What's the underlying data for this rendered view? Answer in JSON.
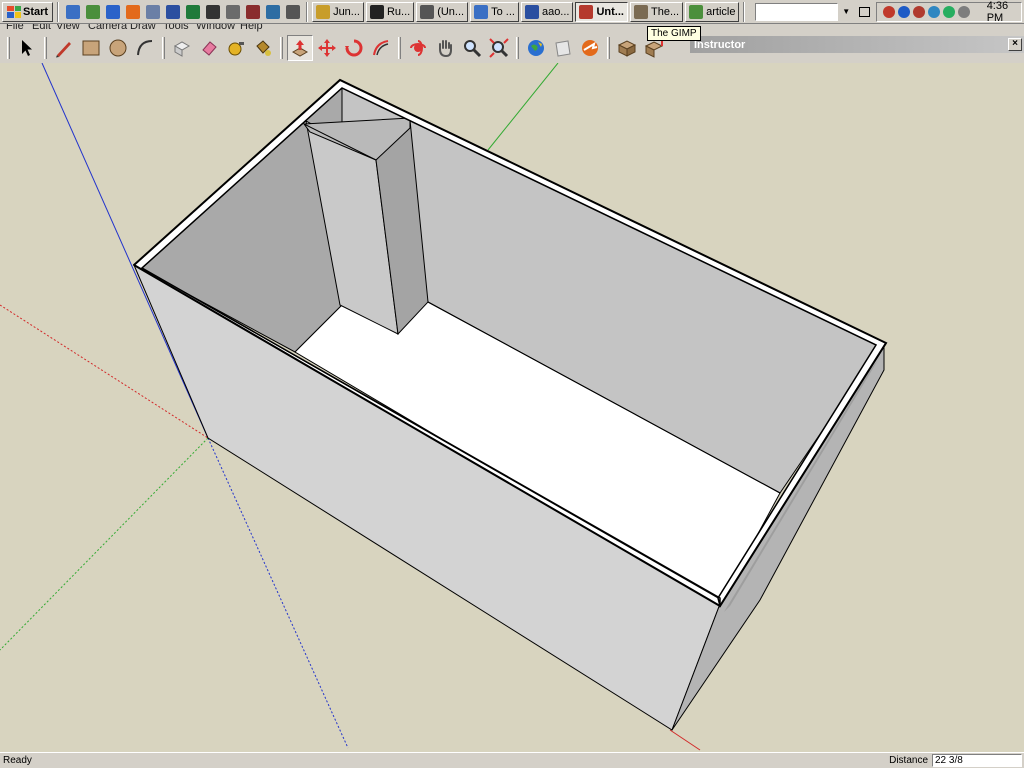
{
  "taskbar": {
    "start_label": "Start",
    "quick_launch": [
      {
        "icon": "notepad-icon",
        "color": "#3a6fc4"
      },
      {
        "icon": "search-icon",
        "color": "#4b8f3c"
      },
      {
        "icon": "internet-explorer-icon",
        "color": "#2a62c9"
      },
      {
        "icon": "firefox-icon",
        "color": "#e36a1b"
      },
      {
        "icon": "windows-explorer-icon",
        "color": "#6a7fa6"
      },
      {
        "icon": "word-icon",
        "color": "#2b4fa0"
      },
      {
        "icon": "excel-icon",
        "color": "#1f7a3a"
      },
      {
        "icon": "media-icon",
        "color": "#333333"
      },
      {
        "icon": "pen-icon",
        "color": "#6b6b6b"
      },
      {
        "icon": "scissors-icon",
        "color": "#8a2d2d"
      },
      {
        "icon": "display-icon",
        "color": "#2d6da3"
      },
      {
        "icon": "arrows-icon",
        "color": "#555555"
      }
    ],
    "tasks": [
      {
        "label": "Jun...",
        "color": "#c89d2a",
        "active": false
      },
      {
        "label": "Ru...",
        "color": "#222222",
        "active": false
      },
      {
        "label": "(Un...",
        "color": "#555555",
        "active": false
      },
      {
        "label": "To ...",
        "color": "#3a6fc4",
        "active": false
      },
      {
        "label": "aao...",
        "color": "#2b4fa0",
        "active": false
      },
      {
        "label": "Unt...",
        "color": "#b5392d",
        "active": true
      },
      {
        "label": "The...",
        "color": "#7a6a52",
        "active": false
      },
      {
        "label": "article",
        "color": "#4b8f3c",
        "active": false
      }
    ],
    "tray_icons": [
      {
        "icon": "shield-icon",
        "color": "#c0392b"
      },
      {
        "icon": "antivirus-icon",
        "color": "#1e5bc6"
      },
      {
        "icon": "security-icon",
        "color": "#b03a2e"
      },
      {
        "icon": "network-icon",
        "color": "#2e86c1"
      },
      {
        "icon": "globe-icon",
        "color": "#27ae60"
      },
      {
        "icon": "volume-icon",
        "color": "#7d7d7d"
      }
    ],
    "clock": "4:36 PM"
  },
  "tooltip": "The GIMP",
  "menu": [
    "File",
    "Edit",
    "View",
    "Camera",
    "Draw",
    "Tools",
    "Window",
    "Help"
  ],
  "instructor": {
    "title": "Instructor",
    "close_label": "×"
  },
  "statusbar": {
    "status": "Ready",
    "measure_label": "Distance",
    "measure_value": "22 3/8"
  },
  "colors": {
    "viewport_bg": "#d8d4bf",
    "wall_face": "#d0d0d0",
    "wall_side": "#b8b8b8",
    "interior_floor": "#ffffff",
    "axis_red": "#d22a2a",
    "axis_green": "#33aa33",
    "axis_blue": "#2233cc"
  }
}
